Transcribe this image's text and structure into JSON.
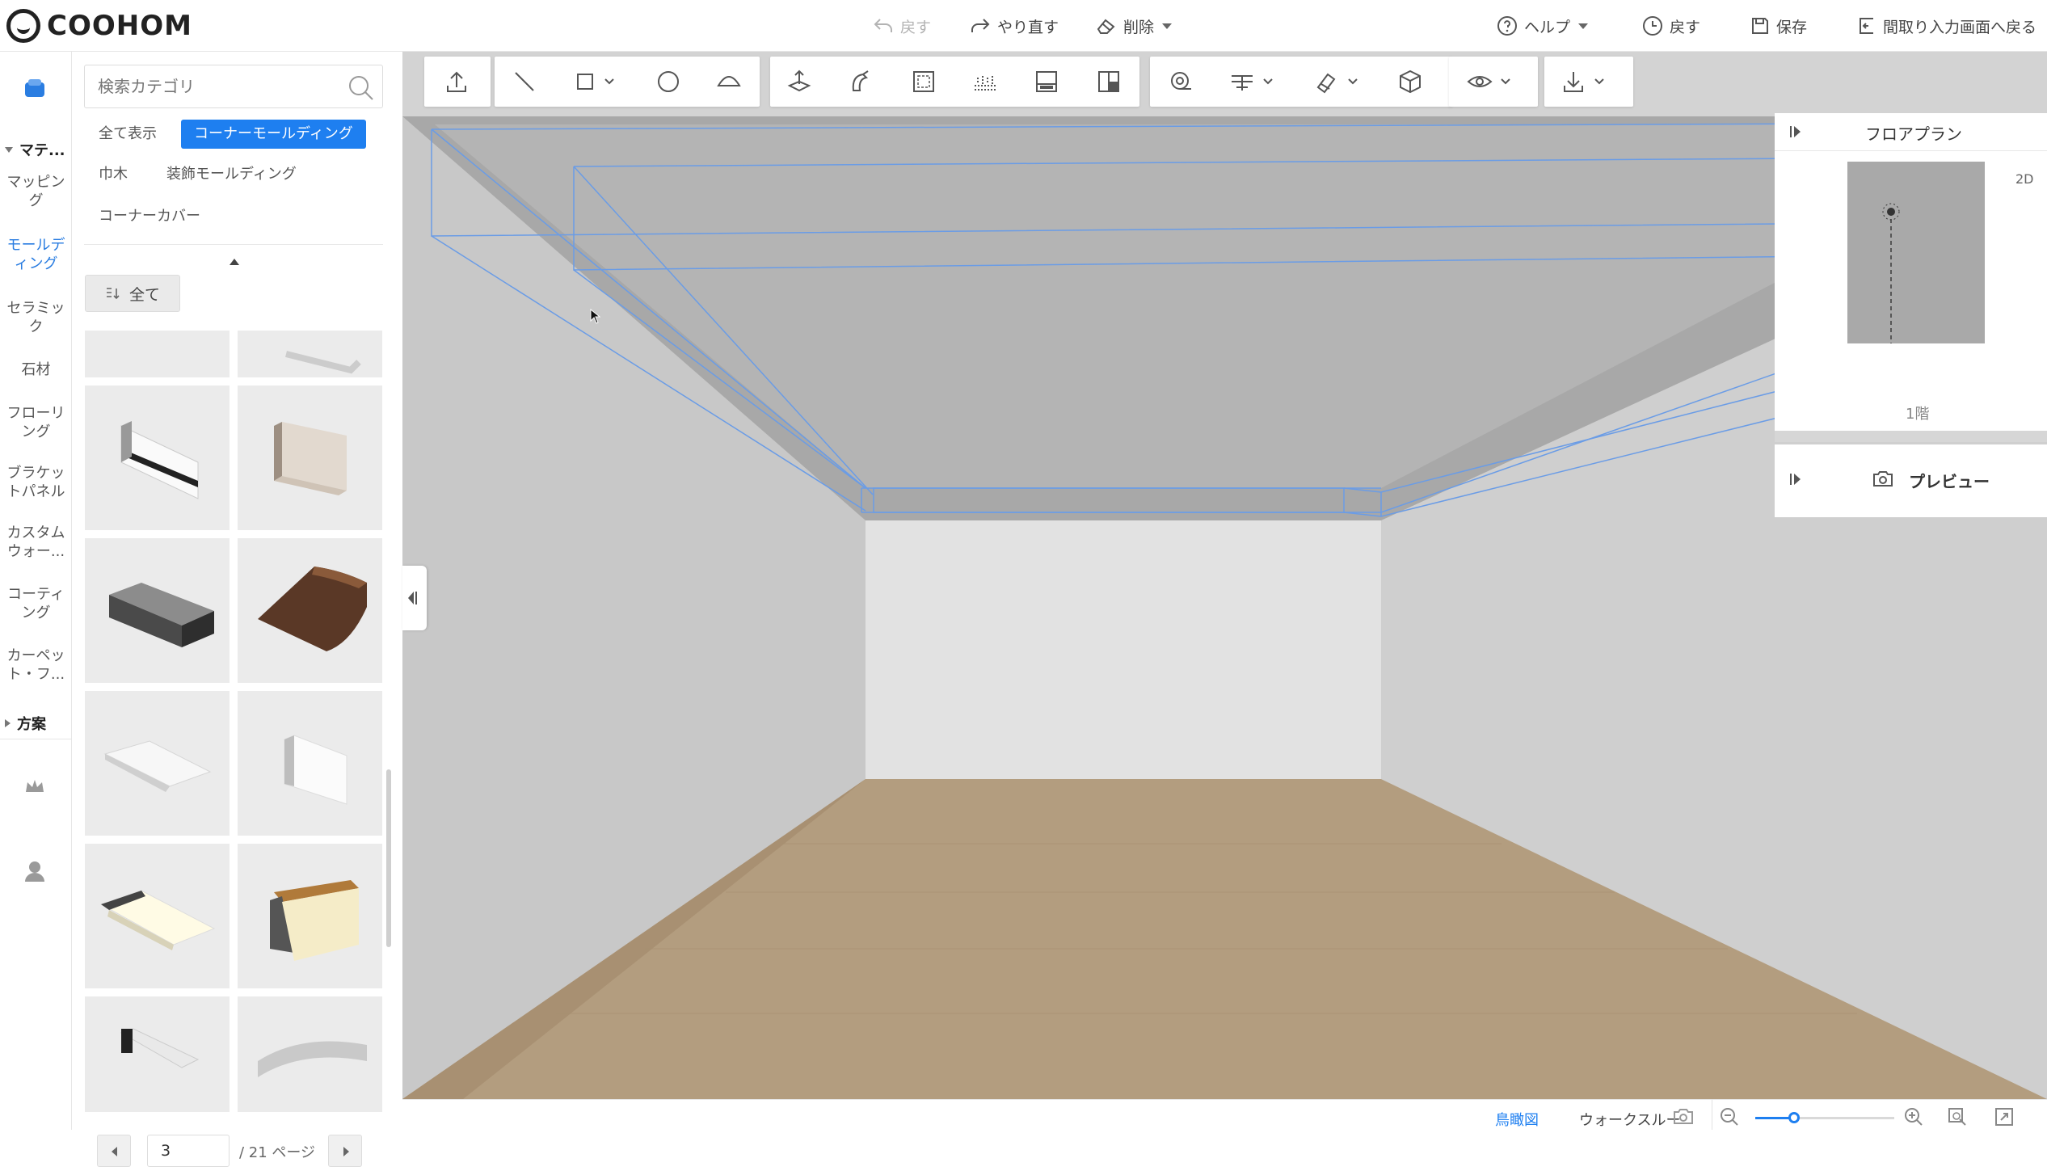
{
  "app": {
    "logo_text": "COOHOM"
  },
  "topbar": {
    "undo": "戻す",
    "redo": "やり直す",
    "delete": "削除",
    "help": "ヘルプ",
    "history": "戻す",
    "save": "保存",
    "back_to_floorplan": "間取り入力画面へ戻る"
  },
  "rail": {
    "group_materials": "マテ...",
    "items": [
      "マッピング",
      "モールディング",
      "セラミック",
      "石材",
      "フローリング",
      "ブラケットパネル",
      "カスタムウォー...",
      "コーティング",
      "カーペット・フ..."
    ],
    "active_index": 1,
    "group_plans": "方案"
  },
  "catalog": {
    "search_placeholder": "検索カテゴリ",
    "chips": [
      "全て表示",
      "コーナーモールディング",
      "巾木",
      "装飾モールディング",
      "コーナーカバー"
    ],
    "active_chip_index": 1,
    "sort_label": "全て",
    "pager": {
      "current": "3",
      "total_label": "/ 21 ページ"
    }
  },
  "right_panel": {
    "floorplan_title": "フロアプラン",
    "view_mode": "2D",
    "floor_label": "1階",
    "preview_title": "プレビュー"
  },
  "status": {
    "bird_view": "鳥瞰図",
    "walkthrough": "ウォークスルー"
  },
  "colors": {
    "accent": "#1e7ff0",
    "floor": "#b09a7c",
    "ceiling": "#a9a9a9",
    "wall_left": "#c9c9c9",
    "wall_back": "#e3e3e3",
    "wall_right": "#cfcfcf"
  }
}
